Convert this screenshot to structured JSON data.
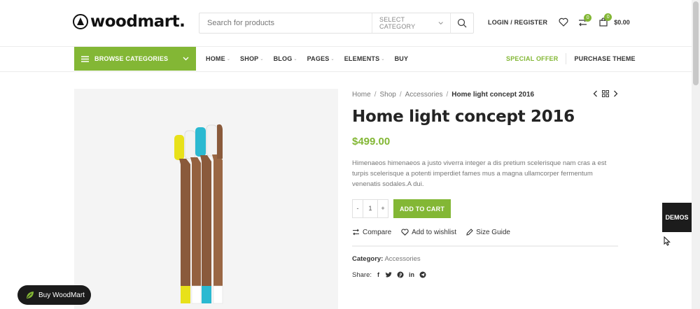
{
  "header": {
    "logo_text": "woodmart.",
    "search_placeholder": "Search for products",
    "category_label": "SELECT CATEGORY",
    "login_label": "LOGIN / REGISTER",
    "compare_count": "0",
    "cart_count": "0",
    "cart_total": "$0.00"
  },
  "nav": {
    "browse_label": "BROWSE CATEGORIES",
    "items": [
      {
        "label": "HOME",
        "dropdown": true
      },
      {
        "label": "SHOP",
        "dropdown": true
      },
      {
        "label": "BLOG",
        "dropdown": true
      },
      {
        "label": "PAGES",
        "dropdown": true
      },
      {
        "label": "ELEMENTS",
        "dropdown": true
      },
      {
        "label": "BUY",
        "dropdown": false
      }
    ],
    "special_offer": "SPECIAL OFFER",
    "purchase_theme": "PURCHASE THEME"
  },
  "breadcrumb": {
    "items": [
      "Home",
      "Shop",
      "Accessories"
    ],
    "current": "Home light concept 2016"
  },
  "product": {
    "title": "Home light concept 2016",
    "price": "$499.00",
    "description": "Himenaeos himenaeos a justo viverra integer a dis pretium scelerisque nam cras a est turpis scelerisque a potenti imperdiet fames mus a magna ullamcorper fermentum venenatis sodales.A dui.",
    "qty_minus": "-",
    "qty_value": "1",
    "qty_plus": "+",
    "add_to_cart": "ADD TO CART",
    "compare": "Compare",
    "wishlist": "Add to wishlist",
    "size_guide": "Size Guide",
    "category_label": "Category:",
    "category_value": "Accessories",
    "share_label": "Share:",
    "image_text": "boogie brush"
  },
  "floating": {
    "demos": "DEMOS",
    "buy_button": "Buy WoodMart"
  },
  "colors": {
    "accent": "#83b735",
    "dark": "#1b1b1b"
  }
}
